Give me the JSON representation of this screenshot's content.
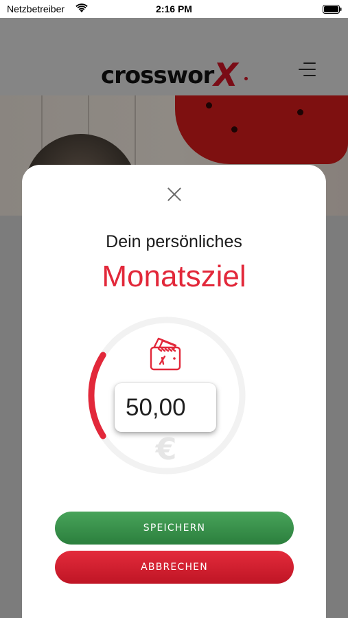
{
  "status_bar": {
    "carrier": "Netzbetreiber",
    "time": "2:16 PM",
    "icons": [
      "wifi-icon",
      "battery-icon"
    ]
  },
  "header": {
    "logo_text": "crossworx",
    "logo_main": "crosswor",
    "logo_x": "X",
    "menu_icon": "menu-icon"
  },
  "modal": {
    "close_icon": "close-icon",
    "subtitle": "Dein persönliches",
    "title": "Monatsziel",
    "goal_icon": "wallet-goal-icon",
    "amount_value": "50,00",
    "currency_symbol": "€",
    "progress_fraction": 0.18,
    "save_label": "SPEICHERN",
    "cancel_label": "ABBRECHEN"
  },
  "colors": {
    "accent_red": "#e2283a",
    "save_green": "#3a9149",
    "cancel_red": "#d11e2f",
    "ring_track": "#f2f2f2"
  }
}
